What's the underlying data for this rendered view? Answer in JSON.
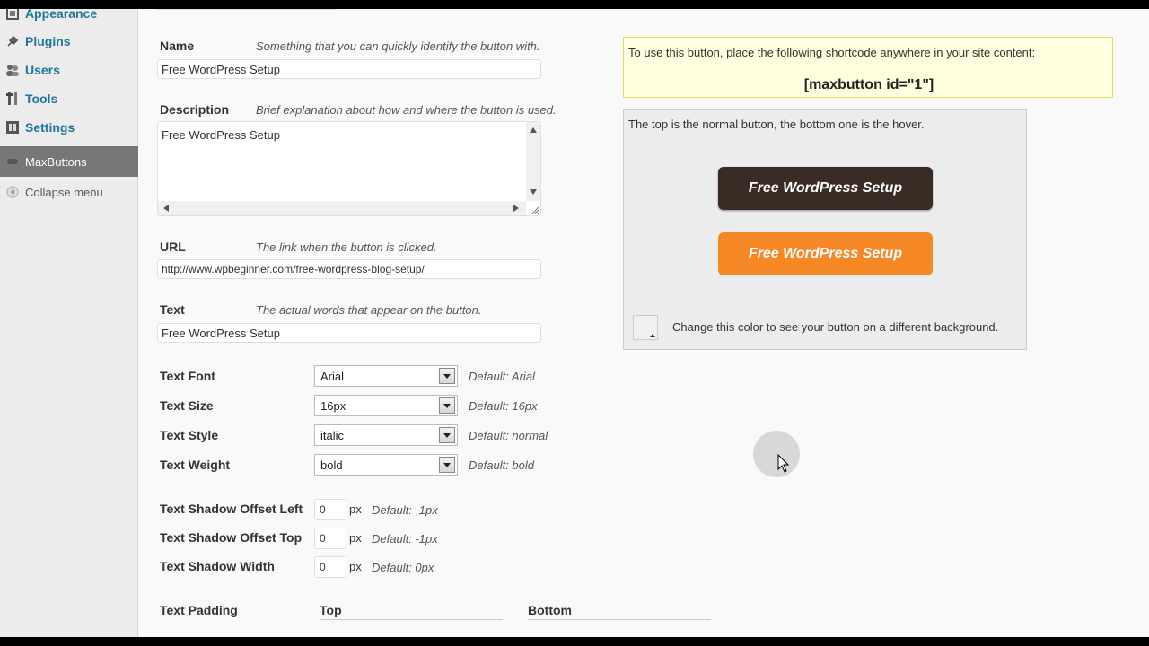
{
  "sidebar": {
    "items": [
      {
        "label": "Appearance",
        "icon": "appearance-icon"
      },
      {
        "label": "Plugins",
        "icon": "plugin-icon"
      },
      {
        "label": "Users",
        "icon": "users-icon"
      },
      {
        "label": "Tools",
        "icon": "tools-icon"
      },
      {
        "label": "Settings",
        "icon": "settings-icon"
      },
      {
        "label": "MaxButtons",
        "icon": "maxbuttons-icon",
        "active": true
      },
      {
        "label": "Collapse menu",
        "icon": "collapse-icon"
      }
    ]
  },
  "form": {
    "name": {
      "label": "Name",
      "hint": "Something that you can quickly identify the button with.",
      "value": "Free WordPress Setup"
    },
    "description": {
      "label": "Description",
      "hint": "Brief explanation about how and where the button is used.",
      "value": "Free WordPress Setup"
    },
    "url": {
      "label": "URL",
      "hint": "The link when the button is clicked.",
      "value": "http://www.wpbeginner.com/free-wordpress-blog-setup/"
    },
    "text": {
      "label": "Text",
      "hint": "The actual words that appear on the button.",
      "value": "Free WordPress Setup"
    },
    "text_font": {
      "label": "Text Font",
      "value": "Arial",
      "default": "Default: Arial"
    },
    "text_size": {
      "label": "Text Size",
      "value": "16px",
      "default": "Default: 16px"
    },
    "text_style": {
      "label": "Text Style",
      "value": "italic",
      "default": "Default: normal"
    },
    "text_weight": {
      "label": "Text Weight",
      "value": "bold",
      "default": "Default: bold"
    },
    "shadow_left": {
      "label": "Text Shadow Offset Left",
      "value": "0",
      "unit": "px",
      "default": "Default: -1px"
    },
    "shadow_top": {
      "label": "Text Shadow Offset Top",
      "value": "0",
      "unit": "px",
      "default": "Default: -1px"
    },
    "shadow_width": {
      "label": "Text Shadow Width",
      "value": "0",
      "unit": "px",
      "default": "Default: 0px"
    },
    "padding": {
      "label": "Text Padding",
      "col_top": "Top",
      "col_bottom": "Bottom"
    }
  },
  "shortcode": {
    "instruction": "To use this button, place the following shortcode anywhere in your site content:",
    "code": "[maxbutton id=\"1\"]"
  },
  "preview": {
    "caption": "The top is the normal button, the bottom one is the hover.",
    "normal_label": "Free WordPress Setup",
    "hover_label": "Free WordPress Setup",
    "normal_color": "#3a2c25",
    "hover_color": "#f68826",
    "bg_hint": "Change this color to see your button on a different background."
  }
}
